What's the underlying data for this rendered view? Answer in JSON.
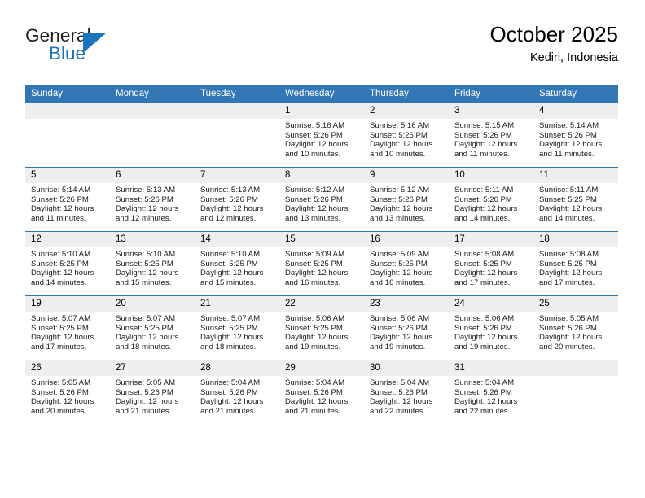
{
  "brand": {
    "name_top": "General",
    "name_bottom": "Blue",
    "accent_color": "#1c75bc",
    "triangle_icon": "triangle-icon"
  },
  "header": {
    "title": "October 2025",
    "subtitle": "Kediri, Indonesia",
    "header_bg_color": "#3376b4",
    "daynum_bg_color": "#eeeeee"
  },
  "calendar": {
    "weekday_headers": [
      "Sunday",
      "Monday",
      "Tuesday",
      "Wednesday",
      "Thursday",
      "Friday",
      "Saturday"
    ],
    "labels": {
      "sunrise_prefix": "Sunrise:",
      "sunset_prefix": "Sunset:",
      "daylight_prefix": "Daylight:"
    },
    "weeks": [
      [
        {
          "day": "",
          "empty": true
        },
        {
          "day": "",
          "empty": true
        },
        {
          "day": "",
          "empty": true
        },
        {
          "day": "1",
          "sunrise": "Sunrise: 5:16 AM",
          "sunset": "Sunset: 5:26 PM",
          "daylight": "Daylight: 12 hours and 10 minutes."
        },
        {
          "day": "2",
          "sunrise": "Sunrise: 5:16 AM",
          "sunset": "Sunset: 5:26 PM",
          "daylight": "Daylight: 12 hours and 10 minutes."
        },
        {
          "day": "3",
          "sunrise": "Sunrise: 5:15 AM",
          "sunset": "Sunset: 5:26 PM",
          "daylight": "Daylight: 12 hours and 11 minutes."
        },
        {
          "day": "4",
          "sunrise": "Sunrise: 5:14 AM",
          "sunset": "Sunset: 5:26 PM",
          "daylight": "Daylight: 12 hours and 11 minutes."
        }
      ],
      [
        {
          "day": "5",
          "sunrise": "Sunrise: 5:14 AM",
          "sunset": "Sunset: 5:26 PM",
          "daylight": "Daylight: 12 hours and 11 minutes."
        },
        {
          "day": "6",
          "sunrise": "Sunrise: 5:13 AM",
          "sunset": "Sunset: 5:26 PM",
          "daylight": "Daylight: 12 hours and 12 minutes."
        },
        {
          "day": "7",
          "sunrise": "Sunrise: 5:13 AM",
          "sunset": "Sunset: 5:26 PM",
          "daylight": "Daylight: 12 hours and 12 minutes."
        },
        {
          "day": "8",
          "sunrise": "Sunrise: 5:12 AM",
          "sunset": "Sunset: 5:26 PM",
          "daylight": "Daylight: 12 hours and 13 minutes."
        },
        {
          "day": "9",
          "sunrise": "Sunrise: 5:12 AM",
          "sunset": "Sunset: 5:26 PM",
          "daylight": "Daylight: 12 hours and 13 minutes."
        },
        {
          "day": "10",
          "sunrise": "Sunrise: 5:11 AM",
          "sunset": "Sunset: 5:26 PM",
          "daylight": "Daylight: 12 hours and 14 minutes."
        },
        {
          "day": "11",
          "sunrise": "Sunrise: 5:11 AM",
          "sunset": "Sunset: 5:25 PM",
          "daylight": "Daylight: 12 hours and 14 minutes."
        }
      ],
      [
        {
          "day": "12",
          "sunrise": "Sunrise: 5:10 AM",
          "sunset": "Sunset: 5:25 PM",
          "daylight": "Daylight: 12 hours and 14 minutes."
        },
        {
          "day": "13",
          "sunrise": "Sunrise: 5:10 AM",
          "sunset": "Sunset: 5:25 PM",
          "daylight": "Daylight: 12 hours and 15 minutes."
        },
        {
          "day": "14",
          "sunrise": "Sunrise: 5:10 AM",
          "sunset": "Sunset: 5:25 PM",
          "daylight": "Daylight: 12 hours and 15 minutes."
        },
        {
          "day": "15",
          "sunrise": "Sunrise: 5:09 AM",
          "sunset": "Sunset: 5:25 PM",
          "daylight": "Daylight: 12 hours and 16 minutes."
        },
        {
          "day": "16",
          "sunrise": "Sunrise: 5:09 AM",
          "sunset": "Sunset: 5:25 PM",
          "daylight": "Daylight: 12 hours and 16 minutes."
        },
        {
          "day": "17",
          "sunrise": "Sunrise: 5:08 AM",
          "sunset": "Sunset: 5:25 PM",
          "daylight": "Daylight: 12 hours and 17 minutes."
        },
        {
          "day": "18",
          "sunrise": "Sunrise: 5:08 AM",
          "sunset": "Sunset: 5:25 PM",
          "daylight": "Daylight: 12 hours and 17 minutes."
        }
      ],
      [
        {
          "day": "19",
          "sunrise": "Sunrise: 5:07 AM",
          "sunset": "Sunset: 5:25 PM",
          "daylight": "Daylight: 12 hours and 17 minutes."
        },
        {
          "day": "20",
          "sunrise": "Sunrise: 5:07 AM",
          "sunset": "Sunset: 5:25 PM",
          "daylight": "Daylight: 12 hours and 18 minutes."
        },
        {
          "day": "21",
          "sunrise": "Sunrise: 5:07 AM",
          "sunset": "Sunset: 5:25 PM",
          "daylight": "Daylight: 12 hours and 18 minutes."
        },
        {
          "day": "22",
          "sunrise": "Sunrise: 5:06 AM",
          "sunset": "Sunset: 5:25 PM",
          "daylight": "Daylight: 12 hours and 19 minutes."
        },
        {
          "day": "23",
          "sunrise": "Sunrise: 5:06 AM",
          "sunset": "Sunset: 5:26 PM",
          "daylight": "Daylight: 12 hours and 19 minutes."
        },
        {
          "day": "24",
          "sunrise": "Sunrise: 5:06 AM",
          "sunset": "Sunset: 5:26 PM",
          "daylight": "Daylight: 12 hours and 19 minutes."
        },
        {
          "day": "25",
          "sunrise": "Sunrise: 5:05 AM",
          "sunset": "Sunset: 5:26 PM",
          "daylight": "Daylight: 12 hours and 20 minutes."
        }
      ],
      [
        {
          "day": "26",
          "sunrise": "Sunrise: 5:05 AM",
          "sunset": "Sunset: 5:26 PM",
          "daylight": "Daylight: 12 hours and 20 minutes."
        },
        {
          "day": "27",
          "sunrise": "Sunrise: 5:05 AM",
          "sunset": "Sunset: 5:26 PM",
          "daylight": "Daylight: 12 hours and 21 minutes."
        },
        {
          "day": "28",
          "sunrise": "Sunrise: 5:04 AM",
          "sunset": "Sunset: 5:26 PM",
          "daylight": "Daylight: 12 hours and 21 minutes."
        },
        {
          "day": "29",
          "sunrise": "Sunrise: 5:04 AM",
          "sunset": "Sunset: 5:26 PM",
          "daylight": "Daylight: 12 hours and 21 minutes."
        },
        {
          "day": "30",
          "sunrise": "Sunrise: 5:04 AM",
          "sunset": "Sunset: 5:26 PM",
          "daylight": "Daylight: 12 hours and 22 minutes."
        },
        {
          "day": "31",
          "sunrise": "Sunrise: 5:04 AM",
          "sunset": "Sunset: 5:26 PM",
          "daylight": "Daylight: 12 hours and 22 minutes."
        },
        {
          "day": "",
          "empty": true
        }
      ]
    ]
  }
}
